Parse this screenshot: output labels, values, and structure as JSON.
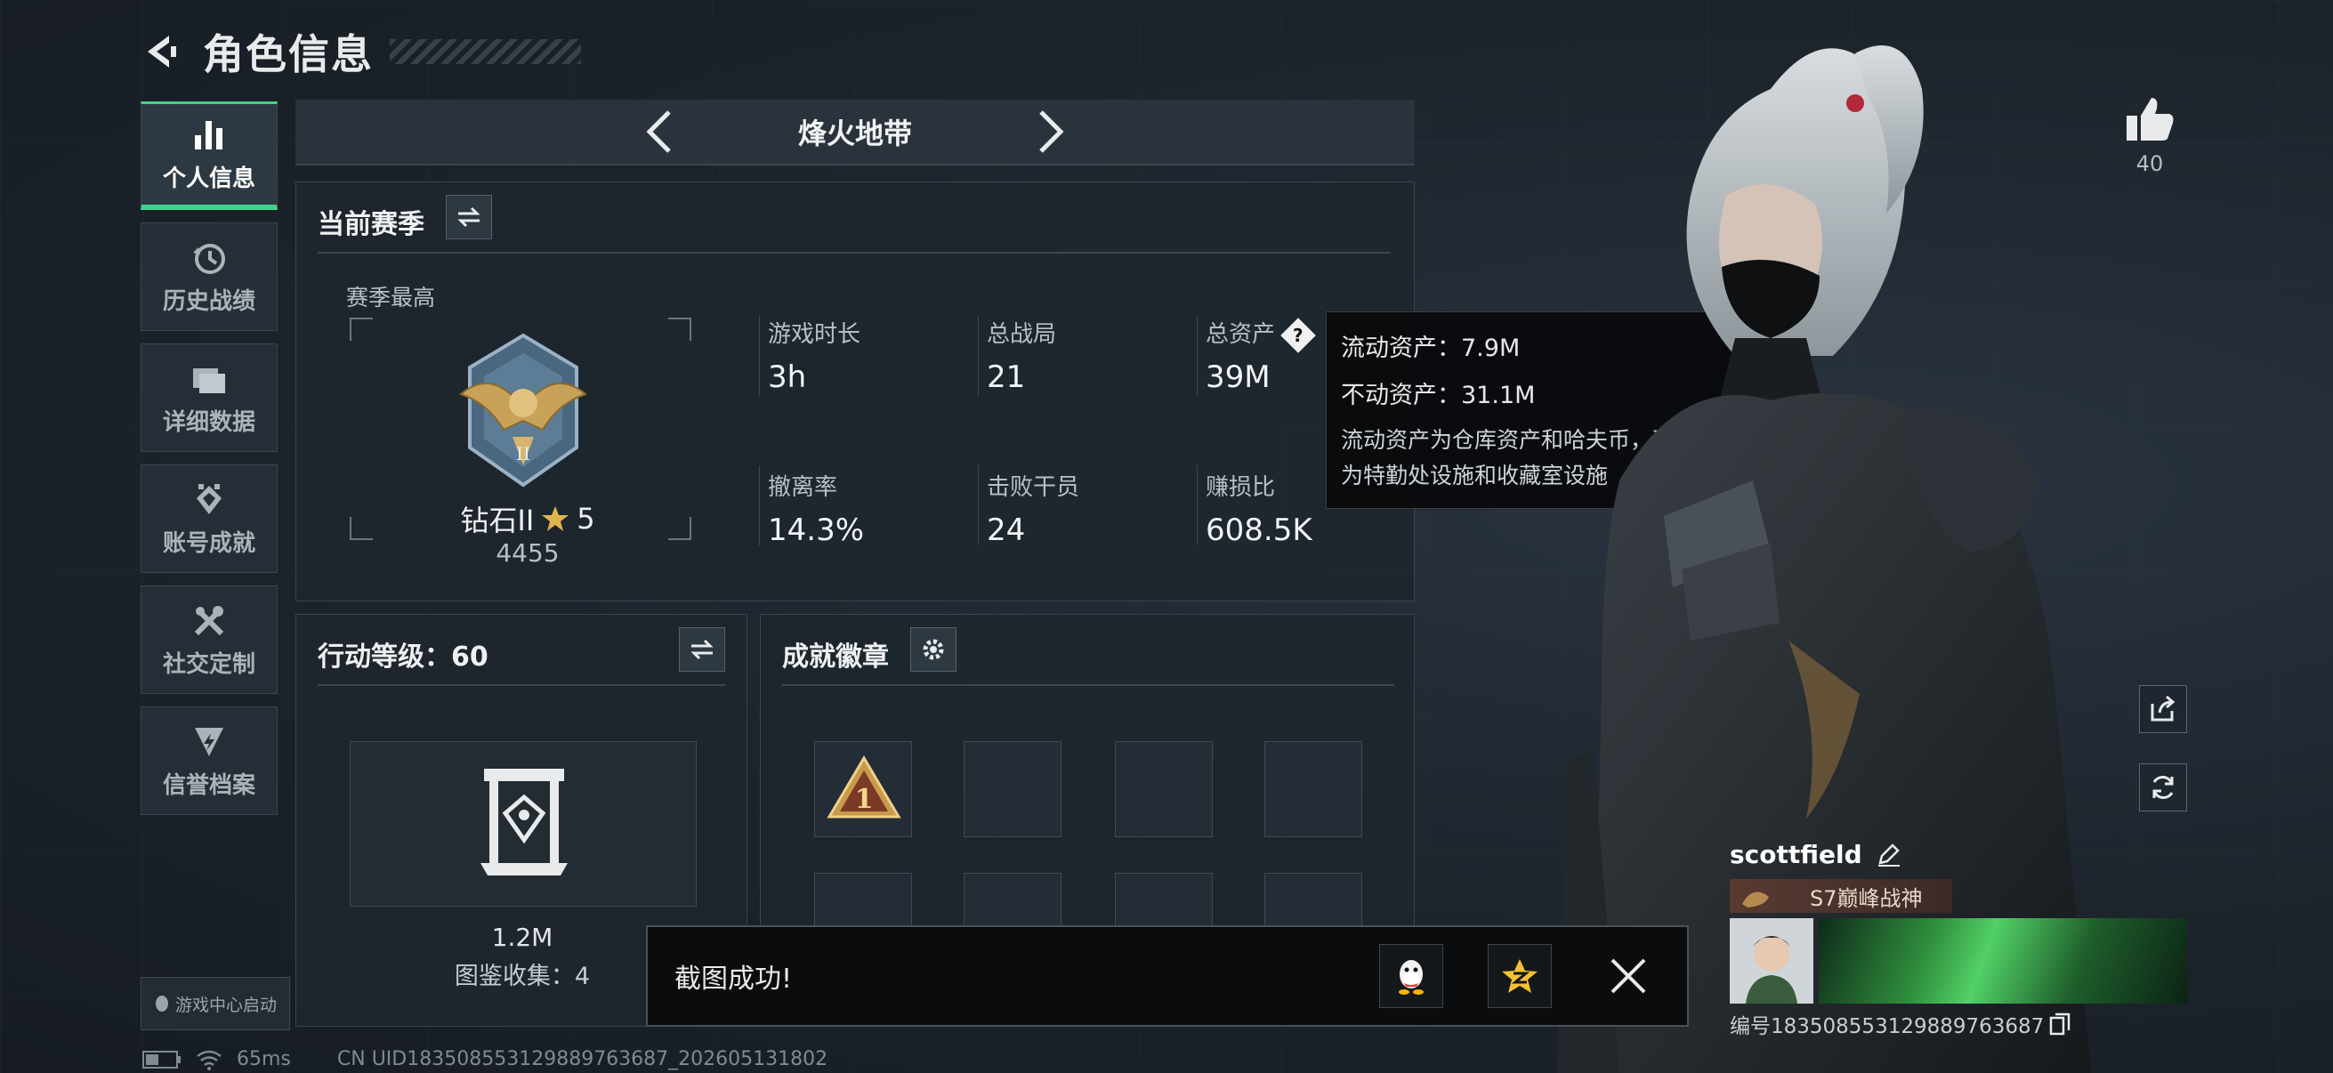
{
  "header": {
    "title": "角色信息"
  },
  "nav": [
    {
      "label": "个人信息",
      "icon": "bar-chart-icon",
      "active": true
    },
    {
      "label": "历史战绩",
      "icon": "history-icon",
      "active": false
    },
    {
      "label": "详细数据",
      "icon": "folder-icon",
      "active": false
    },
    {
      "label": "账号成就",
      "icon": "achievement-icon",
      "active": false
    },
    {
      "label": "社交定制",
      "icon": "tools-icon",
      "active": false
    },
    {
      "label": "信誉档案",
      "icon": "reputation-icon",
      "active": false
    }
  ],
  "game_center": "游戏中心启动",
  "mode": {
    "name": "烽火地带"
  },
  "season": {
    "title": "当前赛季",
    "best_label": "赛季最高",
    "rank_name": "钻石II",
    "rank_stars": "5",
    "rank_points": "4455",
    "stats": [
      {
        "label": "游戏时长",
        "value": "3h"
      },
      {
        "label": "总战局",
        "value": "21"
      },
      {
        "label": "总资产",
        "value": "39M"
      },
      {
        "label": "撤离率",
        "value": "14.3%"
      },
      {
        "label": "击败干员",
        "value": "24"
      },
      {
        "label": "赚损比",
        "value": "608.5K"
      }
    ]
  },
  "tooltip": {
    "liquid": "流动资产：7.9M",
    "fixed": "不动资产：31.1M",
    "desc_1": "流动资产为仓库资产和哈夫币，不动资产",
    "desc_2": "为特勤处设施和收藏室设施"
  },
  "level": {
    "title": "行动等级：60",
    "value": "1.2M",
    "collection": "图鉴收集：4"
  },
  "badges": {
    "title": "成就徽章",
    "first_badge_number": "1"
  },
  "toast": {
    "text": "截图成功!"
  },
  "status": {
    "ping": "65ms",
    "uid_text": "CN UID183508553129889763687_202605131802"
  },
  "like": {
    "count": "40"
  },
  "profile": {
    "username": "scottfield",
    "title": "S7巅峰战神",
    "id_text": "编号183508553129889763687"
  },
  "colors": {
    "accent": "#40d48a",
    "panel": "#1e262e",
    "background": "#1c232b"
  }
}
